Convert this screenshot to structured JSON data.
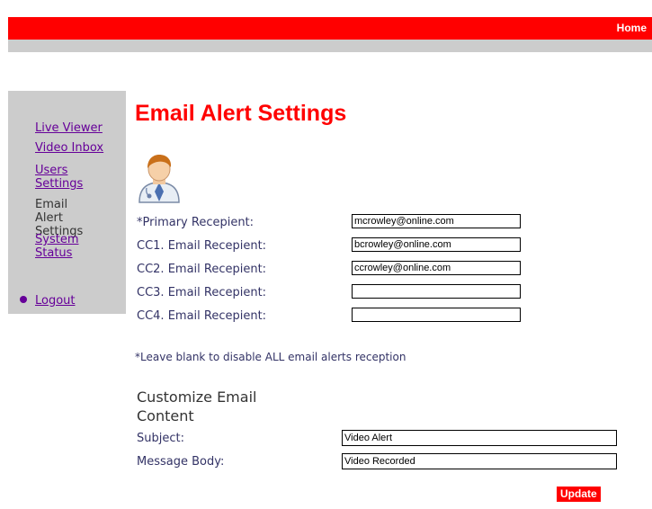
{
  "header": {
    "home_label": "Home"
  },
  "sidebar": {
    "items": [
      {
        "label": "Live Viewer",
        "active": false
      },
      {
        "label": "Video Inbox",
        "active": false
      },
      {
        "label": "Users Settings",
        "active": false
      },
      {
        "label": "Email Alert Settings",
        "active": true
      },
      {
        "label": "System Status",
        "active": false
      }
    ],
    "logout_label": "Logout"
  },
  "main": {
    "title": "Email Alert Settings",
    "recipients": [
      {
        "label": "*Primary Recepient:",
        "value": "mcrowley@online.com"
      },
      {
        "label": "CC1. Email Recepient:",
        "value": "bcrowley@online.com"
      },
      {
        "label": "CC2. Email Recepient:",
        "value": "ccrowley@online.com"
      },
      {
        "label": "CC3. Email Recepient:",
        "value": ""
      },
      {
        "label": "CC4. Email Recepient:",
        "value": ""
      }
    ],
    "note": "*Leave blank to disable ALL email alerts reception",
    "customize": {
      "title": "Customize Email Content",
      "subject_label": "Subject:",
      "subject_value": "Video Alert",
      "body_label": "Message Body:",
      "body_value": "Video Recorded"
    },
    "update_label": "Update"
  },
  "colors": {
    "accent": "#ff0000",
    "sidebar_bg": "#cccccc",
    "link": "#660099",
    "label": "#333366"
  },
  "icons": {
    "avatar": "user-avatar-icon",
    "active_bullet": "bullet-icon"
  }
}
